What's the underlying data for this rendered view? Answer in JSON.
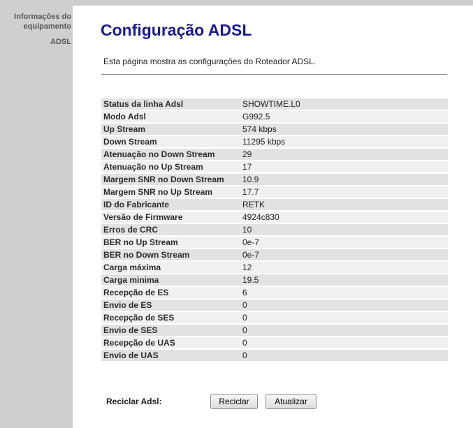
{
  "sidebar": {
    "items": [
      {
        "label": "Informações do equipamento"
      },
      {
        "label": "ADSL"
      }
    ]
  },
  "main": {
    "title": "Configuração ADSL",
    "description": "Esta página mostra as configurações do Roteador ADSL.",
    "rows": [
      {
        "label": "Status da linha Adsl",
        "value": "SHOWTIME.L0"
      },
      {
        "label": "Modo Adsl",
        "value": "G992.5"
      },
      {
        "label": "Up Stream",
        "value": "574 kbps"
      },
      {
        "label": "Down Stream",
        "value": "11295 kbps"
      },
      {
        "label": "Atenuação no Down Stream",
        "value": "29"
      },
      {
        "label": "Atenuação no Up Stream",
        "value": "17"
      },
      {
        "label": "Margem SNR no Down Stream",
        "value": "10.9"
      },
      {
        "label": "Margem SNR no Up Stream",
        "value": "17.7"
      },
      {
        "label": "ID do Fabricante",
        "value": "RETK"
      },
      {
        "label": "Versão de Firmware",
        "value": "4924c830"
      },
      {
        "label": "Erros de CRC",
        "value": "10"
      },
      {
        "label": "BER no Up Stream",
        "value": "0e-7"
      },
      {
        "label": "BER no Down Stream",
        "value": "0e-7"
      },
      {
        "label": "Carga máxima",
        "value": "12"
      },
      {
        "label": "Carga minima",
        "value": "19.5"
      },
      {
        "label": "Recepção de ES",
        "value": "6"
      },
      {
        "label": "Envio de ES",
        "value": "0"
      },
      {
        "label": "Recepção de SES",
        "value": "0"
      },
      {
        "label": "Envio de SES",
        "value": "0"
      },
      {
        "label": "Recepção de UAS",
        "value": "0"
      },
      {
        "label": "Envio de UAS",
        "value": "0"
      }
    ],
    "reset": {
      "label": "Reciclar Adsl:",
      "button_label": "Reciclar"
    },
    "refresh_button_label": "Atualizar"
  },
  "colors": {
    "title": "#1a1a8c",
    "sidebar_background": "#cfcfcf",
    "row_dark": "#e2e2e2",
    "row_light": "#f0f0f0"
  }
}
